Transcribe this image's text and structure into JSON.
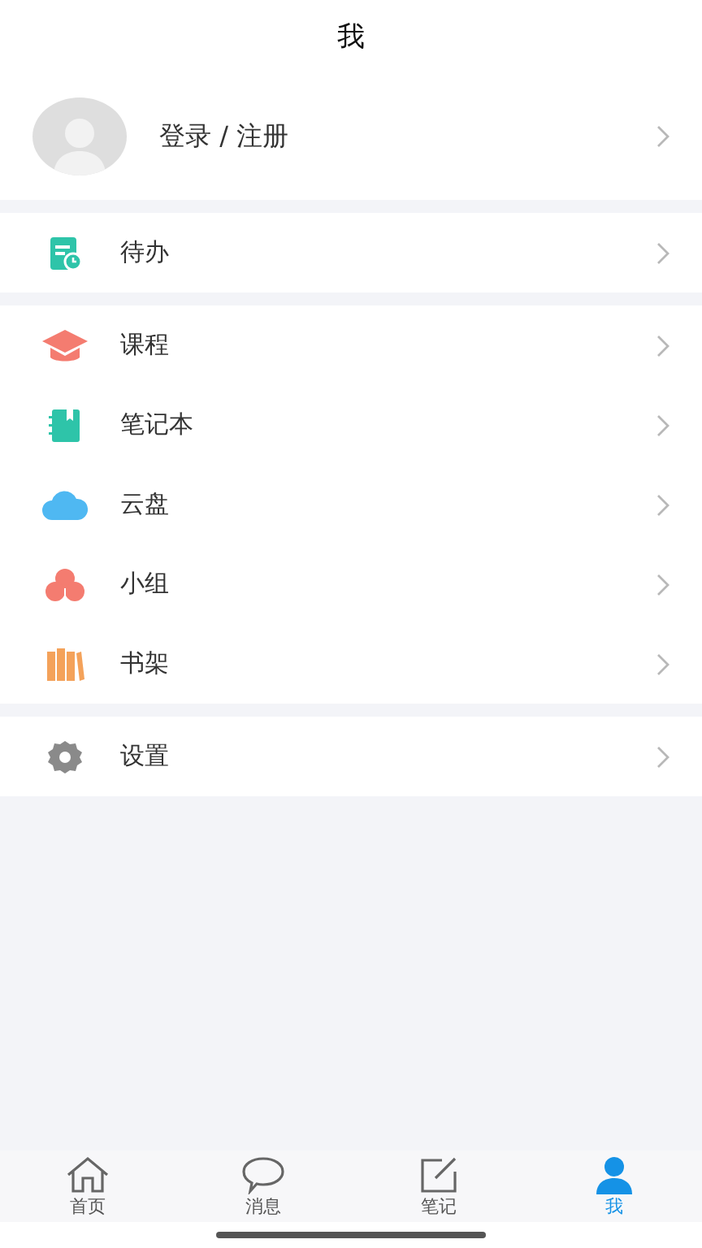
{
  "header": {
    "title": "我"
  },
  "profile": {
    "label": "登录 / 注册"
  },
  "sections": [
    {
      "items": [
        {
          "kind": "todo",
          "label": "待办"
        }
      ]
    },
    {
      "items": [
        {
          "kind": "course",
          "label": "课程"
        },
        {
          "kind": "notebook",
          "label": "笔记本"
        },
        {
          "kind": "cloud",
          "label": "云盘"
        },
        {
          "kind": "group",
          "label": "小组"
        },
        {
          "kind": "shelf",
          "label": "书架"
        }
      ]
    },
    {
      "items": [
        {
          "kind": "settings",
          "label": "设置"
        }
      ]
    }
  ],
  "tabs": [
    {
      "kind": "home",
      "label": "首页",
      "selected": false
    },
    {
      "kind": "message",
      "label": "消息",
      "selected": false
    },
    {
      "kind": "note",
      "label": "笔记",
      "selected": false
    },
    {
      "kind": "me",
      "label": "我",
      "selected": true
    }
  ]
}
